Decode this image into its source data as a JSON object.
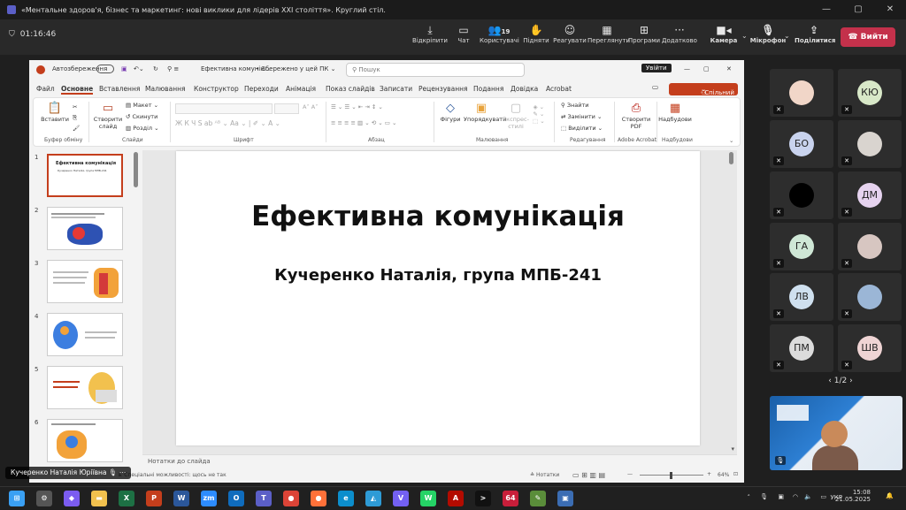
{
  "window": {
    "title": "«Ментальне здоров'я, бізнес та маркетинг: нові виклики для лідерів XXI століття». Круглий стіл.",
    "controls": [
      "—",
      "▢",
      "✕"
    ]
  },
  "meeting": {
    "timer": "01:16:46",
    "toolbar": [
      {
        "label": "Відкріпити",
        "icon": "unpin-icon"
      },
      {
        "label": "Чат",
        "icon": "chat-icon"
      },
      {
        "label": "Користувачі",
        "icon": "people-icon",
        "badge": "19"
      },
      {
        "label": "Підняти",
        "icon": "raise-hand-icon"
      },
      {
        "label": "Реагувати",
        "icon": "react-icon"
      },
      {
        "label": "Переглянути",
        "icon": "view-icon"
      },
      {
        "label": "Програми",
        "icon": "apps-icon"
      },
      {
        "label": "Додатково",
        "icon": "more-icon"
      },
      {
        "label": "Камера",
        "icon": "camera-icon"
      },
      {
        "label": "Мікрофон",
        "icon": "mic-icon"
      },
      {
        "label": "Поділитися",
        "icon": "share-icon"
      }
    ],
    "leave_label": "Вийти",
    "pager": "1/2",
    "self_name": "Кучеренко Наталія Юріївна"
  },
  "participants": [
    {
      "initials": "",
      "color": "#f1d6c8",
      "photo": true
    },
    {
      "initials": "КЮ",
      "color": "#d8e8c8"
    },
    {
      "initials": "БО",
      "color": "#c9d3ee"
    },
    {
      "initials": "",
      "color": "#d9d4cf",
      "photo": true
    },
    {
      "initials": "",
      "color": "#000000"
    },
    {
      "initials": "ДМ",
      "color": "#e6d3ef"
    },
    {
      "initials": "ГА",
      "color": "#cfe7d6"
    },
    {
      "initials": "",
      "color": "#d7c6c1",
      "photo": true
    },
    {
      "initials": "ЛВ",
      "color": "#cfe0ef"
    },
    {
      "initials": "",
      "color": "#9bb6d6",
      "photo": true
    },
    {
      "initials": "ПМ",
      "color": "#dcdcdc"
    },
    {
      "initials": "ШВ",
      "color": "#efd4d4"
    }
  ],
  "ppt": {
    "autosave": "Автозбереження",
    "doc_name": "Ефективна комунік...",
    "saved": "Збережено у цей ПК",
    "search_placeholder": "Пошук",
    "tooltip": "Увійти",
    "tabs": [
      "Файл",
      "Основне",
      "Вставлення",
      "Малювання",
      "Конструктор",
      "Переходи",
      "Анімація",
      "Показ слайдів",
      "Записати",
      "Рецензування",
      "Подання",
      "Довідка",
      "Acrobat"
    ],
    "share_label": "Спільний доступ",
    "ribbon": {
      "paste": "Вставити",
      "clipboard": "Буфер обміну",
      "new_slide": "Створити слайд",
      "layout": "Макет",
      "reset": "Скинути",
      "sections": "Розділ",
      "slides_group": "Слайди",
      "font_group": "Шрифт",
      "paragraph_group": "Абзац",
      "shapes": "Фігури",
      "arrange": "Упорядкувати",
      "quick_styles": "Експрес-стилі",
      "drawing_group": "Малювання",
      "find": "Знайти",
      "replace": "Замінити",
      "select": "Виділити",
      "editing_group": "Редагування",
      "create_pdf": "Створити PDF",
      "acrobat_group": "Adobe Acrobat",
      "addins": "Надбудови",
      "addins_group": "Надбудови"
    },
    "thumbs": [
      {
        "num": "1",
        "title": "Ефективна комунікація",
        "sub": "Кучеренко Наталія, група МПБ-241",
        "selected": true
      },
      {
        "num": "2"
      },
      {
        "num": "3"
      },
      {
        "num": "4"
      },
      {
        "num": "5"
      },
      {
        "num": "6"
      }
    ],
    "slide": {
      "title": "Ефективна комунікація",
      "subtitle": "Кучеренко Наталія, група МПБ-241"
    },
    "notes_placeholder": "Нотатки до слайда",
    "status": {
      "accessibility": "Спеціальні можливості: щось не так",
      "notes": "Нотатки",
      "zoom": "64%"
    }
  },
  "taskbar": {
    "time": "15:08",
    "date": "21.05.2025",
    "lang": "УКР",
    "apps": [
      {
        "name": "start",
        "color": "#3aa0f3",
        "glyph": "⊞"
      },
      {
        "name": "settings",
        "color": "#555555",
        "glyph": "⚙"
      },
      {
        "name": "copilot",
        "color": "#7b5cf0",
        "glyph": "◆"
      },
      {
        "name": "explorer",
        "color": "#f2c14e",
        "glyph": "▬"
      },
      {
        "name": "excel",
        "color": "#1d7044",
        "glyph": "X"
      },
      {
        "name": "powerpoint",
        "color": "#c43e1c",
        "glyph": "P"
      },
      {
        "name": "word",
        "color": "#2b579a",
        "glyph": "W"
      },
      {
        "name": "zoom",
        "color": "#2d8cff",
        "glyph": "zm"
      },
      {
        "name": "outlook",
        "color": "#0f6cbd",
        "glyph": "O"
      },
      {
        "name": "teams",
        "color": "#5b5fc7",
        "glyph": "T"
      },
      {
        "name": "chrome",
        "color": "#db4437",
        "glyph": "●"
      },
      {
        "name": "firefox",
        "color": "#ff7139",
        "glyph": "●"
      },
      {
        "name": "edge",
        "color": "#0c8ecc",
        "glyph": "e"
      },
      {
        "name": "photos",
        "color": "#2e9bd6",
        "glyph": "◭"
      },
      {
        "name": "viber",
        "color": "#7360f2",
        "glyph": "V"
      },
      {
        "name": "whatsapp",
        "color": "#25d366",
        "glyph": "W"
      },
      {
        "name": "acrobat",
        "color": "#b30b00",
        "glyph": "A"
      },
      {
        "name": "cmd",
        "color": "#111111",
        "glyph": ">"
      },
      {
        "name": "app64",
        "color": "#c81e3a",
        "glyph": "64"
      },
      {
        "name": "paint",
        "color": "#5a8d3a",
        "glyph": "✎"
      },
      {
        "name": "save",
        "color": "#3b6db3",
        "glyph": "▣"
      }
    ]
  }
}
